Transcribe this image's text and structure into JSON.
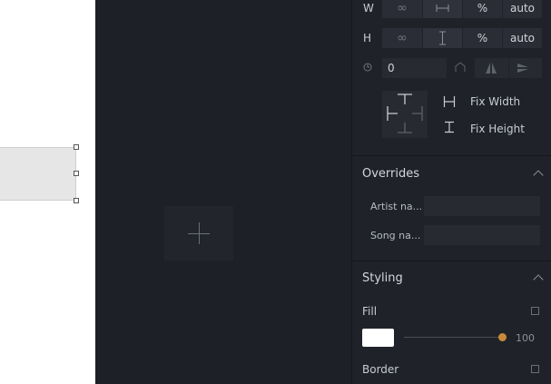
{
  "size": {
    "w_label": "W",
    "h_label": "H",
    "w_options": {
      "infinity": "∞",
      "percent": "%",
      "auto": "auto"
    },
    "h_options": {
      "infinity": "∞",
      "percent": "%",
      "auto": "auto"
    }
  },
  "rotation": {
    "value": "0"
  },
  "constraints": {
    "fix_width_label": "Fix Width",
    "fix_height_label": "Fix Height"
  },
  "overrides": {
    "title": "Overrides",
    "fields": [
      {
        "label": "Artist na...",
        "value": ""
      },
      {
        "label": "Song na...",
        "value": ""
      }
    ]
  },
  "styling": {
    "title": "Styling",
    "fill_label": "Fill",
    "fill_color": "#ffffff",
    "opacity_value": "100",
    "opacity_fraction": 1.0,
    "border_label": "Border",
    "accent_color": "#c88a3a"
  }
}
